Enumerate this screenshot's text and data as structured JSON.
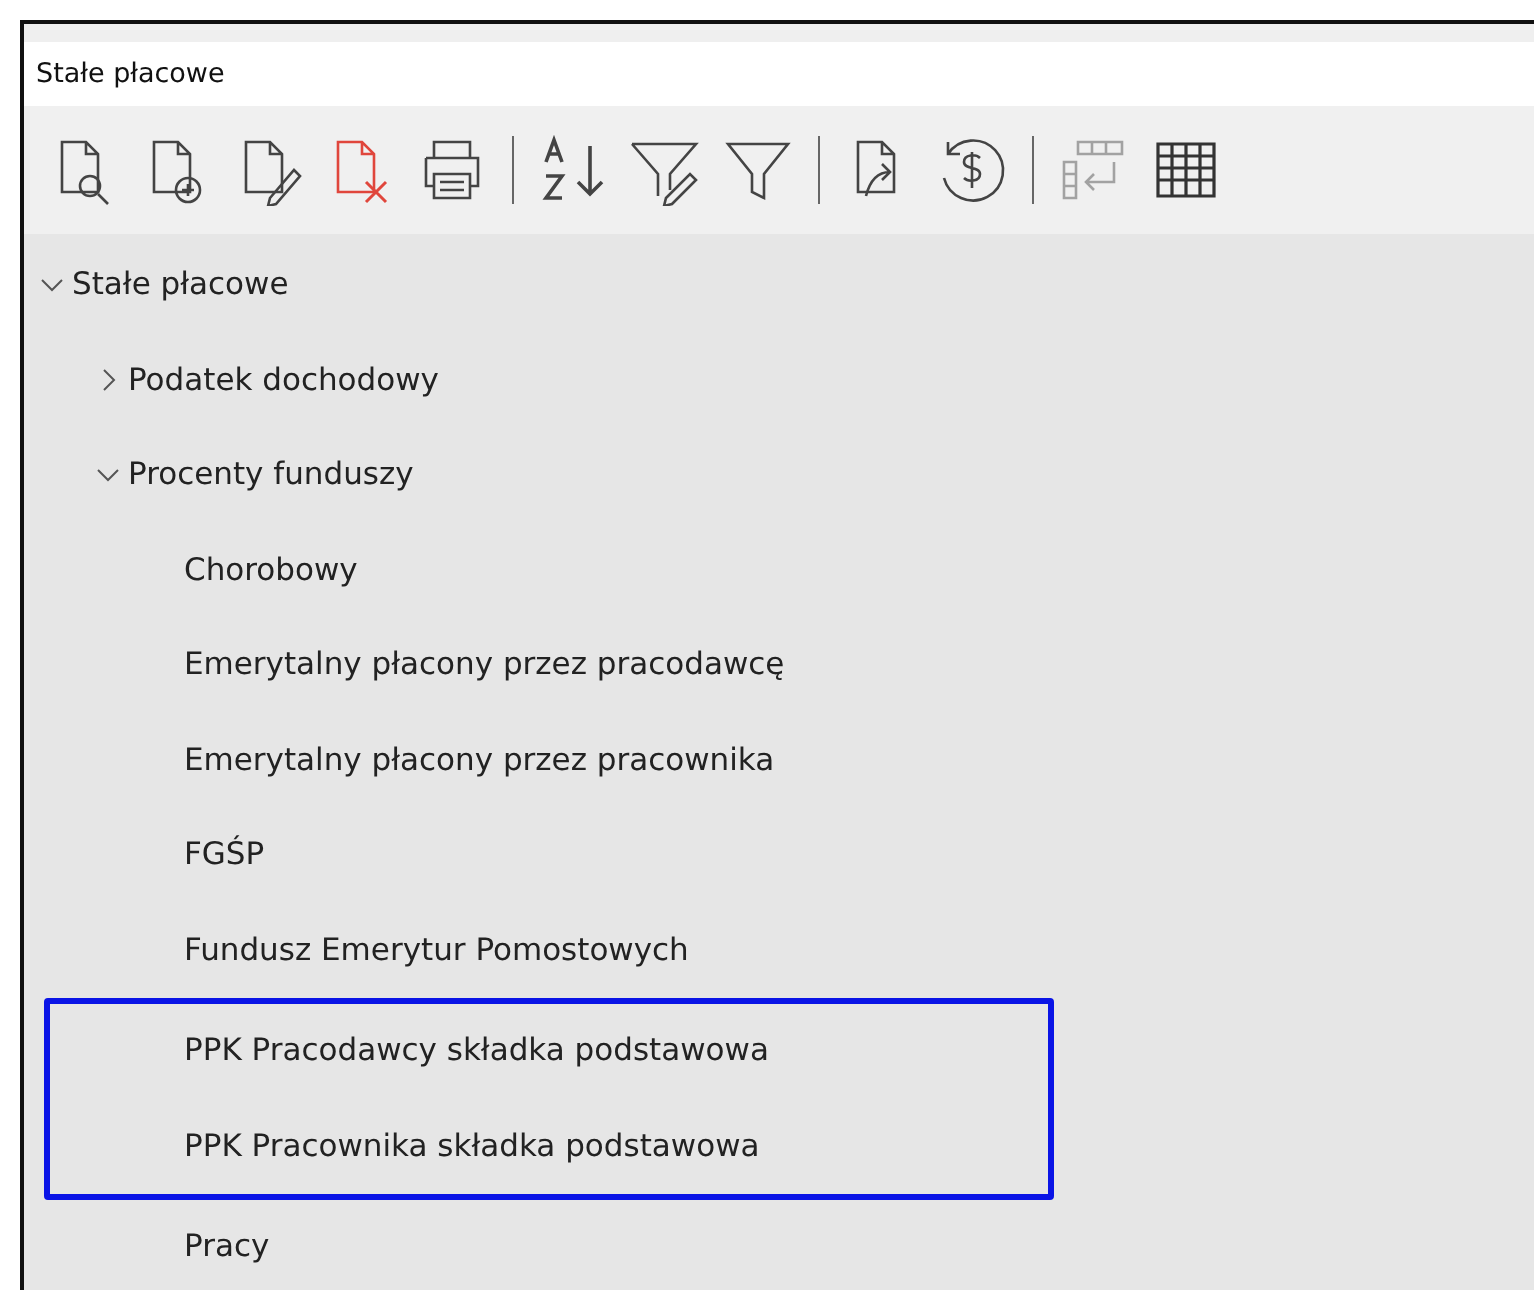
{
  "window": {
    "title": "Stałe płacowe"
  },
  "toolbar": {
    "groups": [
      {
        "buttons": [
          {
            "disabled": false
          },
          {
            "disabled": false
          },
          {
            "disabled": false
          },
          {
            "disabled": false
          },
          {
            "disabled": false
          }
        ]
      },
      {
        "buttons": [
          {
            "disabled": false
          },
          {
            "disabled": false
          },
          {
            "disabled": false
          }
        ]
      },
      {
        "buttons": [
          {
            "disabled": false
          },
          {
            "disabled": false
          }
        ]
      },
      {
        "buttons": [
          {
            "disabled": true
          },
          {
            "disabled": false
          }
        ]
      }
    ]
  },
  "tree": {
    "items": [
      {
        "label": "Stałe płacowe",
        "expanded": true,
        "children": [
          {
            "label": "Podatek dochodowy",
            "expanded": false
          },
          {
            "label": "Procenty funduszy",
            "expanded": true,
            "children": [
              {
                "label": "Chorobowy",
                "highlighted": false
              },
              {
                "label": "Emerytalny płacony przez pracodawcę",
                "highlighted": false
              },
              {
                "label": "Emerytalny płacony przez pracownika",
                "highlighted": false
              },
              {
                "label": "FGŚP",
                "highlighted": false
              },
              {
                "label": "Fundusz Emerytur Pomostowych",
                "highlighted": false
              },
              {
                "label": "PPK Pracodawcy składka podstawowa",
                "highlighted": true
              },
              {
                "label": "PPK Pracownika składka podstawowa",
                "highlighted": true
              },
              {
                "label": "Pracy",
                "highlighted": false
              }
            ]
          }
        ]
      }
    ]
  }
}
